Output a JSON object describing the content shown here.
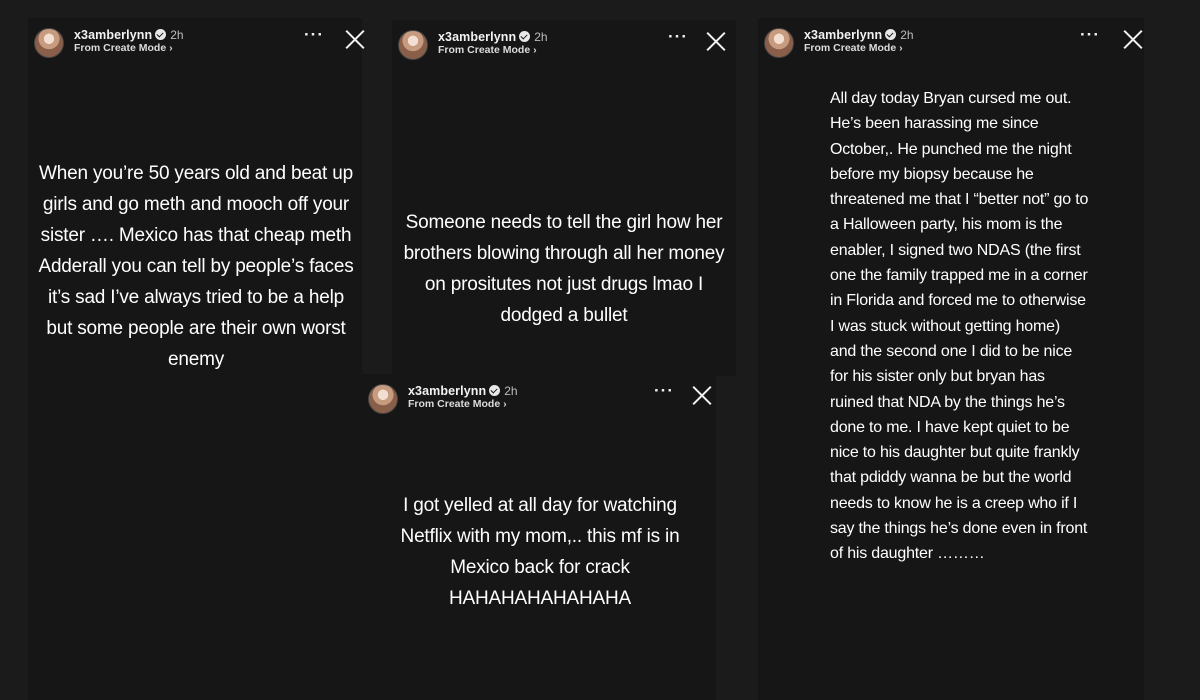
{
  "stories": [
    {
      "user": {
        "username": "x3amberlynn",
        "time": "2h",
        "subtitle": "From Create Mode"
      },
      "icons": {
        "verified": "verified-badge-icon",
        "more": "more-horizontal-icon",
        "close": "close-icon",
        "chevron": "chevron-right-icon"
      },
      "text": "When you’re 50 years old and beat up girls and go meth and mooch off your sister …. Mexico has that cheap meth Adderall you can tell by people’s faces it’s sad I’ve always tried to be a help but some people are their own worst enemy"
    },
    {
      "user": {
        "username": "x3amberlynn",
        "time": "2h",
        "subtitle": "From Create Mode"
      },
      "icons": {
        "verified": "verified-badge-icon",
        "more": "more-horizontal-icon",
        "close": "close-icon",
        "chevron": "chevron-right-icon"
      },
      "text": "Someone needs to tell the girl how her brothers blowing through all her money on prositutes not just drugs lmao I dodged a bullet"
    },
    {
      "user": {
        "username": "x3amberlynn",
        "time": "2h",
        "subtitle": "From Create Mode"
      },
      "icons": {
        "verified": "verified-badge-icon",
        "more": "more-horizontal-icon",
        "close": "close-icon",
        "chevron": "chevron-right-icon"
      },
      "text": "I got yelled at all day for watching Netflix with my mom,.. this mf is in Mexico back for crack HAHAHAHAHAHAHA"
    },
    {
      "user": {
        "username": "x3amberlynn",
        "time": "2h",
        "subtitle": "From Create Mode"
      },
      "icons": {
        "verified": "verified-badge-icon",
        "more": "more-horizontal-icon",
        "close": "close-icon",
        "chevron": "chevron-right-icon"
      },
      "text": "All day today Bryan cursed me out. He’s been harassing me since October,. He punched me the night before my biopsy because he threatened me that I “better not” go to a Halloween party, his mom is the enabler, I signed two NDAS (the first one the family trapped me in a corner in Florida and forced me to otherwise I was stuck without getting home) and the second one I did to be nice for his sister only but bryan has ruined that NDA by the things he’s done to me. I have kept quiet to be nice to his daughter but quite frankly that pdiddy wanna be but the world needs to know he is a creep who if I say the things he’s done even in front of his daughter ………"
    }
  ],
  "colors": {
    "background": "#1b1b1b",
    "panel": "#161616",
    "text": "#ffffff",
    "muted": "#bdbdbd"
  }
}
